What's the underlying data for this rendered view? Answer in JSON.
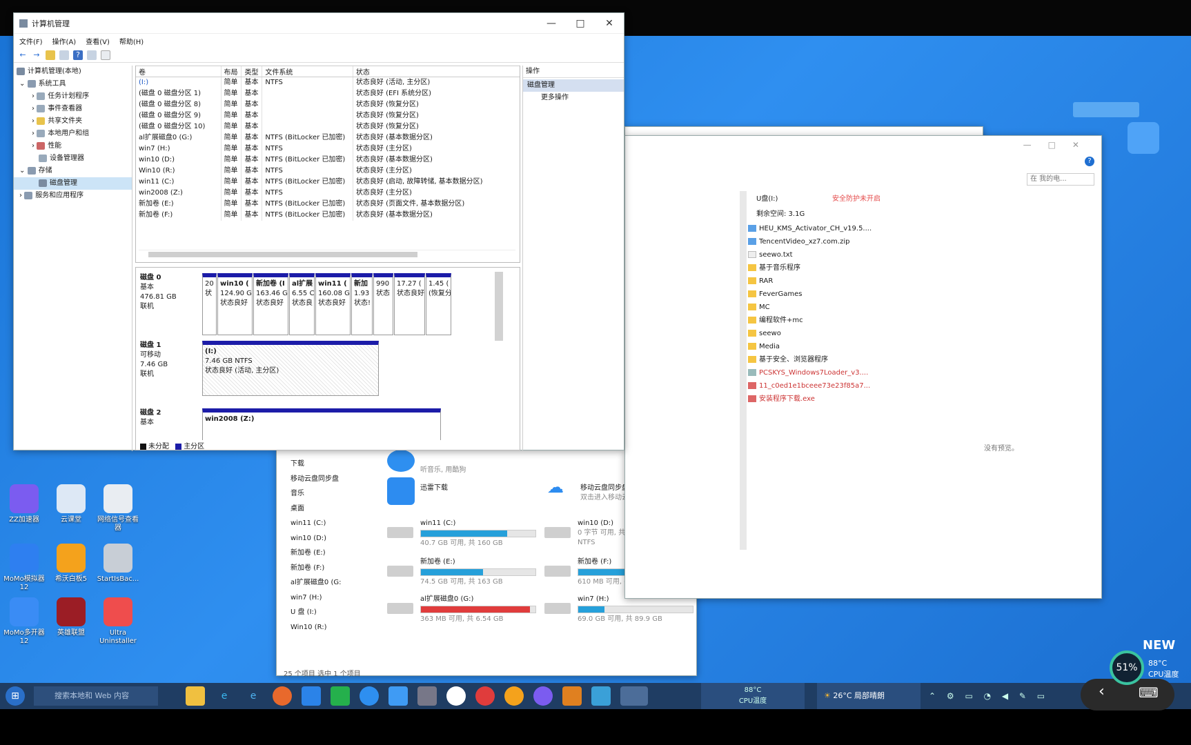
{
  "computer_management": {
    "title": "计算机管理",
    "menu": [
      "文件(F)",
      "操作(A)",
      "查看(V)",
      "帮助(H)"
    ],
    "tree": [
      "计算机管理(本地)",
      "系统工具",
      "任务计划程序",
      "事件查看器",
      "共享文件夹",
      "本地用户和组",
      "性能",
      "设备管理器",
      "存储",
      "磁盘管理",
      "服务和应用程序"
    ],
    "volume_headers": [
      "卷",
      "布局",
      "类型",
      "文件系统",
      "状态"
    ],
    "volumes": [
      [
        "(I:)",
        "简单",
        "基本",
        "NTFS",
        "状态良好 (活动, 主分区)"
      ],
      [
        "(磁盘 0 磁盘分区 1)",
        "简单",
        "基本",
        "",
        "状态良好 (EFI 系统分区)"
      ],
      [
        "(磁盘 0 磁盘分区 8)",
        "简单",
        "基本",
        "",
        "状态良好 (恢复分区)"
      ],
      [
        "(磁盘 0 磁盘分区 9)",
        "简单",
        "基本",
        "",
        "状态良好 (恢复分区)"
      ],
      [
        "(磁盘 0 磁盘分区 10)",
        "简单",
        "基本",
        "",
        "状态良好 (恢复分区)"
      ],
      [
        "al扩展磁盘0 (G:)",
        "简单",
        "基本",
        "NTFS (BitLocker 已加密)",
        "状态良好 (基本数据分区)"
      ],
      [
        "win7 (H:)",
        "简单",
        "基本",
        "NTFS",
        "状态良好 (主分区)"
      ],
      [
        "win10 (D:)",
        "简单",
        "基本",
        "NTFS (BitLocker 已加密)",
        "状态良好 (基本数据分区)"
      ],
      [
        "Win10 (R:)",
        "简单",
        "基本",
        "NTFS",
        "状态良好 (主分区)"
      ],
      [
        "win11 (C:)",
        "简单",
        "基本",
        "NTFS (BitLocker 已加密)",
        "状态良好 (启动, 故障转储, 基本数据分区)"
      ],
      [
        "win2008 (Z:)",
        "简单",
        "基本",
        "NTFS",
        "状态良好 (主分区)"
      ],
      [
        "新加卷 (E:)",
        "简单",
        "基本",
        "NTFS (BitLocker 已加密)",
        "状态良好 (页面文件, 基本数据分区)"
      ],
      [
        "新加卷 (F:)",
        "简单",
        "基本",
        "NTFS (BitLocker 已加密)",
        "状态良好 (基本数据分区)"
      ]
    ],
    "disk0": {
      "name": "磁盘 0",
      "type": "基本",
      "size": "476.81 GB",
      "state": "联机"
    },
    "disk0_parts": [
      {
        "n": "",
        "s": "20",
        "t": "状"
      },
      {
        "n": "win10 (",
        "s": "124.90 G",
        "t": "状态良好"
      },
      {
        "n": "新加卷 (I",
        "s": "163.46 G",
        "t": "状态良好"
      },
      {
        "n": "al扩展",
        "s": "6.55 C",
        "t": "状态良"
      },
      {
        "n": "win11 (",
        "s": "160.08 G",
        "t": "状态良好"
      },
      {
        "n": "新加",
        "s": "1.93",
        "t": "状态!"
      },
      {
        "n": "",
        "s": "990",
        "t": "状态"
      },
      {
        "n": "",
        "s": "17.27 (",
        "t": "状态良好"
      },
      {
        "n": "",
        "s": "1.45 (",
        "t": "(恢复分区)"
      }
    ],
    "disk1": {
      "name": "磁盘 1",
      "type": "可移动",
      "size": "7.46 GB",
      "state": "联机"
    },
    "disk1_part": {
      "n": "(I:)",
      "s": "7.46 GB NTFS",
      "t": "状态良好 (活动, 主分区)"
    },
    "disk2": {
      "name": "磁盘 2",
      "type": "基本"
    },
    "disk2_part": {
      "n": "win2008  (Z:)"
    },
    "legend": [
      "未分配",
      "主分区"
    ],
    "ops_header": "操作",
    "ops_selected": "磁盘管理",
    "ops_more": "更多操作"
  },
  "explorer": {
    "address_placeholder": "在 我的电...",
    "drive_label": "U盘(I:)",
    "security": "安全防护未开启",
    "free_space": "剩余空间: 3.1G",
    "files": [
      "HEU_KMS_Activator_CH_v19.5....",
      "TencentVideo_xz7.com.zip",
      "seewo.txt",
      "基于音乐程序",
      "RAR",
      "FeverGames",
      "MC",
      "编程软件+mc",
      "seewo",
      "Media",
      "基于安全、浏览器程序",
      "PCSKYS_Windows7Loader_v3....",
      "11_c0ed1e1bceee73e23f85a7...",
      "安装程序下载.exe"
    ],
    "no_preview": "没有预览。"
  },
  "this_pc": {
    "sidebar": [
      "下载",
      "移动云盘同步盘",
      "音乐",
      "桌面",
      "win11 (C:)",
      "win10 (D:)",
      "新加卷 (E:)",
      "新加卷 (F:)",
      "al扩展磁盘0 (G:",
      "win7 (H:)",
      "U 盘 (I:)",
      "Win10 (R:)"
    ],
    "apps": [
      {
        "name": "",
        "sub": "听音乐, 用酷狗"
      },
      {
        "name": "迅雷下载",
        "sub": ""
      },
      {
        "name": "移动云盘同步盘",
        "sub": "双击进入移动云盘同步盘"
      }
    ],
    "drives": [
      {
        "name": "win11 (C:)",
        "free": "40.7 GB 可用, 共 160 GB",
        "pct": 0.75,
        "color": "#26a0da"
      },
      {
        "name": "win10 (D:)",
        "free": "0 字节 可用, 共 124 GB",
        "pct": 1.0,
        "color": "#26a0da",
        "extra": "NTFS"
      },
      {
        "name": "新加卷 (E:)",
        "free": "74.5 GB 可用, 共 163 GB",
        "pct": 0.54,
        "color": "#26a0da"
      },
      {
        "name": "新加卷 (F:)",
        "free": "610 MB 可用, 共 1.93 GB",
        "pct": 0.69,
        "color": "#26a0da"
      },
      {
        "name": "al扩展磁盘0 (G:)",
        "free": "363 MB 可用, 共 6.54 GB",
        "pct": 0.95,
        "color": "#e03c3c"
      },
      {
        "name": "win7 (H:)",
        "free": "69.0 GB 可用, 共 89.9 GB",
        "pct": 0.23,
        "color": "#26a0da"
      }
    ],
    "status": "25 个项目    选中 1 个项目"
  },
  "desktop_icons": [
    "ZZ加速器",
    "云课堂",
    "网络信号查看器",
    "MoMo模拟器12",
    "希沃白板5",
    "StartIsBac...",
    "MoMo多开器12",
    "英雄联盟",
    "Ultra Uninstaller"
  ],
  "taskbar": {
    "search_placeholder": "搜索本地和 Web 内容",
    "cpu_temp": "88°C",
    "cpu_label": "CPU温度",
    "weather": "26°C 局部晴朗"
  },
  "overlay": {
    "cpu_pct": "51%",
    "cpu_temp": "88°C",
    "cpu_label": "CPU温度",
    "new_label": "NEW"
  }
}
